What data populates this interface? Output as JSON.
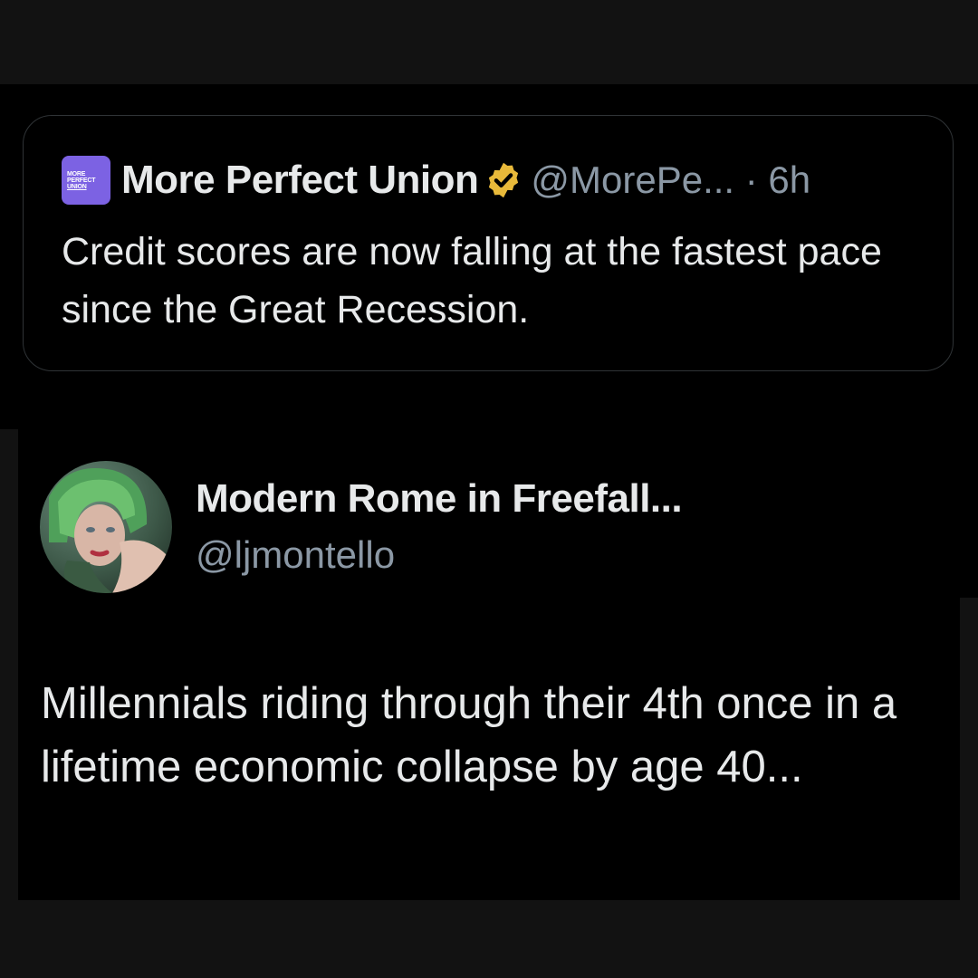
{
  "quoted_tweet": {
    "logo_text_lines": [
      "MORE",
      "PERFECT",
      "UNION"
    ],
    "display_name": "More Perfect Union",
    "verified": true,
    "handle_and_time": "@MorePe... · 6h",
    "text": "Credit scores are now falling at the fastest pace since the Great Recession."
  },
  "tweet": {
    "display_name": "Modern Rome in Freefall...",
    "handle": "@ljmontello",
    "text": "Millennials riding through their 4th once in a lifetime economic collapse by age 40..."
  },
  "colors": {
    "background_outer": "#121212",
    "panel": "#000000",
    "primary_text": "#e7e9ea",
    "secondary_text": "#8b98a5",
    "card_border": "#2f3336",
    "verified_badge": "#e8b93a",
    "logo_bg": "#7c62e3"
  }
}
